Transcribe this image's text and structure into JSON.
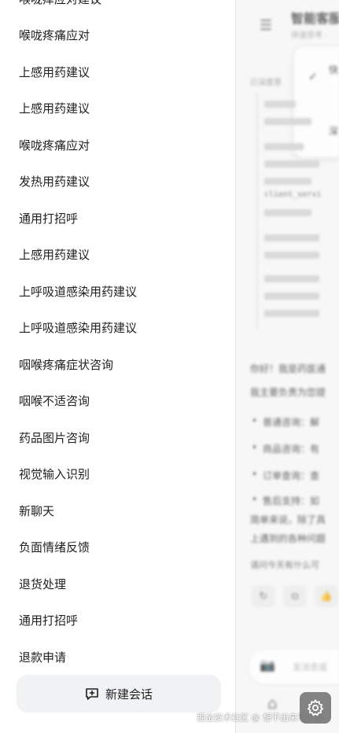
{
  "sidebar": {
    "history": [
      "喉咙痒应对建议",
      "喉咙疼痛应对",
      "上感用药建议",
      "上感用药建议",
      "喉咙疼痛应对",
      "发热用药建议",
      "通用打招呼",
      "上感用药建议",
      "上呼吸道感染用药建议",
      "上呼吸道感染用药建议",
      "咽喉疼痛症状咨询",
      "咽喉不适咨询",
      "药品图片咨询",
      "视觉输入识别",
      "新聊天",
      "负面情绪反馈",
      "退货处理",
      "通用打招呼",
      "退款申请"
    ],
    "new_chat_label": "新建会话",
    "new_chat_icon": "chat-plus-icon"
  },
  "background": {
    "menu_icon": "menu-icon",
    "title": "智能客服",
    "subtitle": "快速思考 ·",
    "dropdown_a": "快",
    "dropdown_b": "深",
    "think_label": "已深度思",
    "code": "client_servi",
    "greeting": "你好！我是药医通",
    "desc": "我主要负责为您提",
    "bullets": [
      "普通咨询：解",
      "商品咨询：有",
      "订单查询：查",
      "售后支持：如"
    ],
    "summary1": "简单来说，除了具",
    "summary2": "上遇到的各种问题",
    "question": "请问今天有什么可",
    "input_placeholder": "发消息或",
    "camera_icon": "camera-icon",
    "home_icon": "home-icon"
  },
  "watermark": "掘金技术社区 @ 想不出来写什么",
  "settings_icon": "settings-gear-icon"
}
